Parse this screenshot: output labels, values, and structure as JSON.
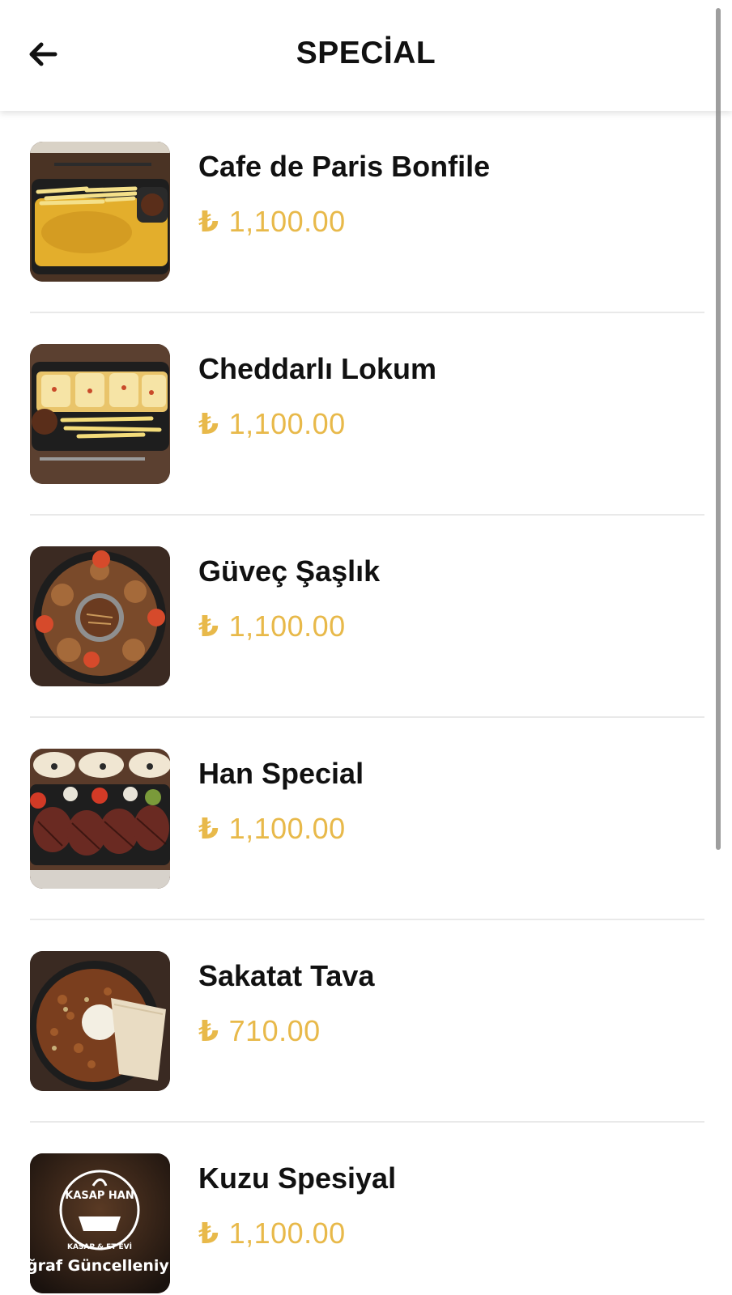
{
  "header": {
    "title": "SPECİAL",
    "back_icon": "arrow-left-icon"
  },
  "currency_symbol": "₺",
  "accent_color": "#e8b94a",
  "items": [
    {
      "name": "Cafe de Paris Bonfile",
      "price": "1,100.00",
      "image": "cafe-de-paris-dish"
    },
    {
      "name": "Cheddarlı Lokum",
      "price": "1,100.00",
      "image": "cheddar-lokum-dish"
    },
    {
      "name": "Güveç Şaşlık",
      "price": "1,100.00",
      "image": "guvec-saslik-dish"
    },
    {
      "name": "Han Special",
      "price": "1,100.00",
      "image": "han-special-dish"
    },
    {
      "name": "Sakatat Tava",
      "price": "710.00",
      "image": "sakatat-tava-dish"
    },
    {
      "name": "Kuzu Spesiyal",
      "price": "1,100.00",
      "image": "kasap-han-logo-placeholder",
      "image_caption": "ğraf Güncelleniy",
      "logo_text": "KASAP HAN · KASAP & ET EVİ"
    }
  ]
}
